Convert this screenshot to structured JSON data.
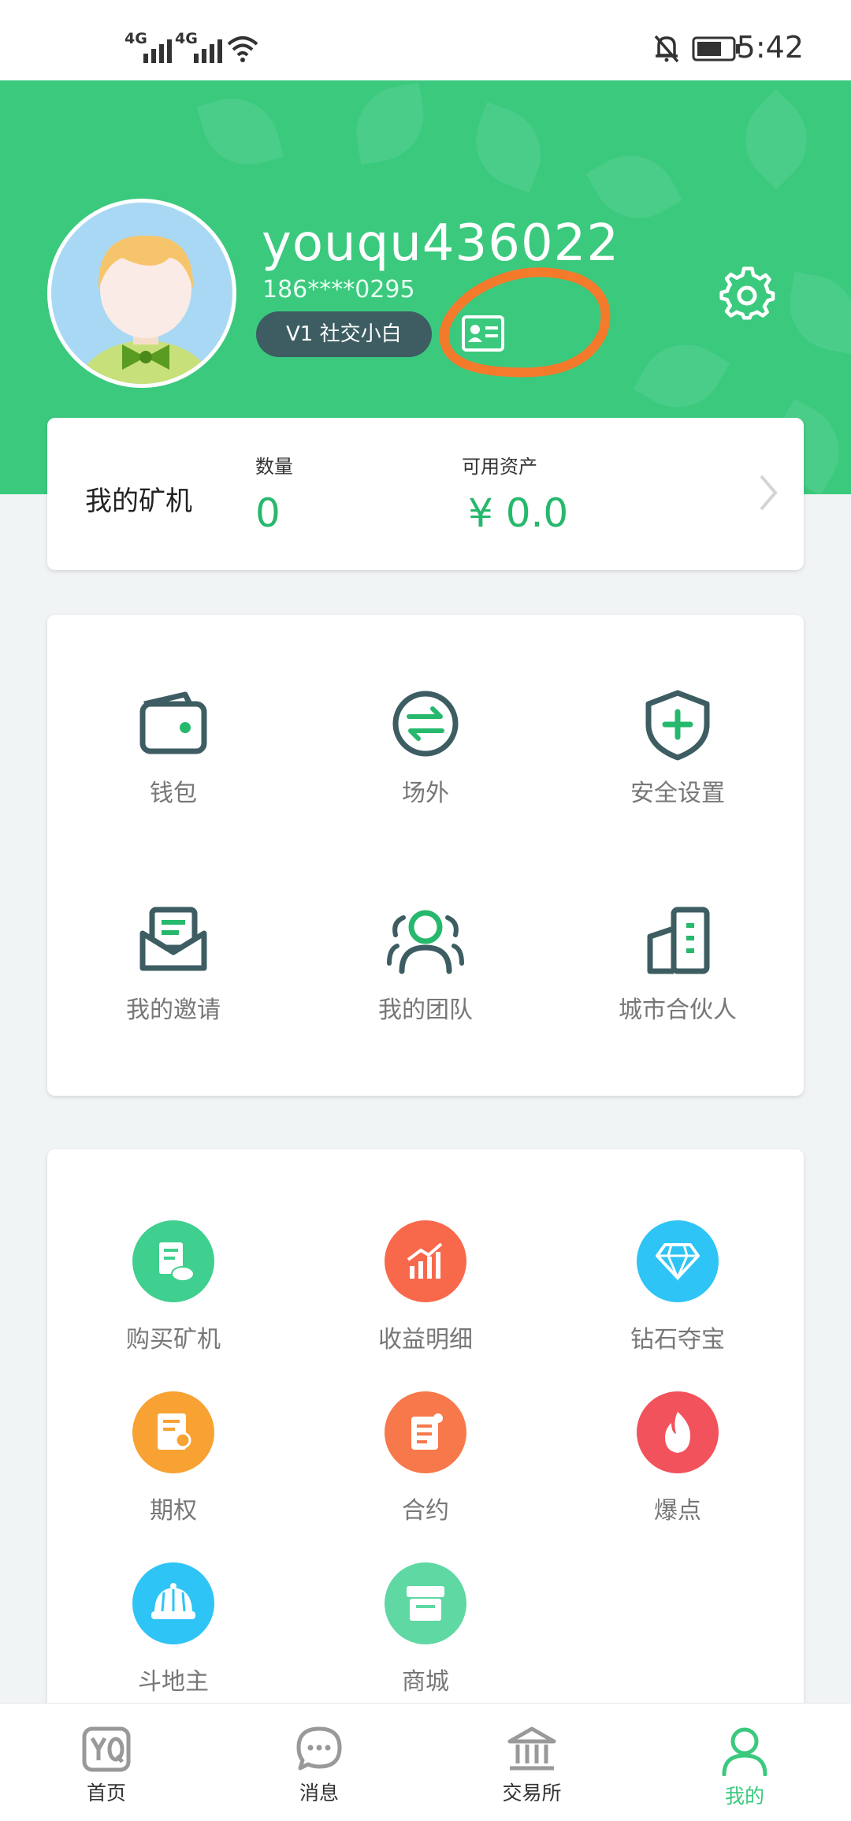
{
  "status_bar": {
    "net1": "4G",
    "net2": "4G",
    "time": "5:42"
  },
  "profile": {
    "username": "youqu436022",
    "phone": "186****0295",
    "level_badge": "V1 社交小白"
  },
  "mining": {
    "title": "我的矿机",
    "quantity_label": "数量",
    "quantity_value": "0",
    "assets_label": "可用资产",
    "assets_value": "¥ 0.0"
  },
  "menu1": {
    "items": [
      {
        "label": "钱包",
        "icon": "wallet-icon"
      },
      {
        "label": "场外",
        "icon": "exchange-icon"
      },
      {
        "label": "安全设置",
        "icon": "shield-icon"
      },
      {
        "label": "我的邀请",
        "icon": "invite-envelope-icon"
      },
      {
        "label": "我的团队",
        "icon": "team-icon"
      },
      {
        "label": "城市合伙人",
        "icon": "buildings-icon"
      }
    ]
  },
  "menu2": {
    "items": [
      {
        "label": "购买矿机",
        "icon": "buy-miner-icon",
        "color": "#3fcf8e"
      },
      {
        "label": "收益明细",
        "icon": "chart-icon",
        "color": "#f8694c"
      },
      {
        "label": "钻石夺宝",
        "icon": "diamond-icon",
        "color": "#2ec4f5"
      },
      {
        "label": "期权",
        "icon": "option-doc-icon",
        "color": "#f8a233"
      },
      {
        "label": "合约",
        "icon": "contract-icon",
        "color": "#f7784a"
      },
      {
        "label": "爆点",
        "icon": "flame-icon",
        "color": "#f2525c"
      },
      {
        "label": "斗地主",
        "icon": "landlord-hat-icon",
        "color": "#2ec4f5"
      },
      {
        "label": "商城",
        "icon": "store-icon",
        "color": "#5fd8a4"
      }
    ]
  },
  "bottom_nav": {
    "items": [
      {
        "label": "首页",
        "icon": "home-yq-icon"
      },
      {
        "label": "消息",
        "icon": "message-icon"
      },
      {
        "label": "交易所",
        "icon": "exchange-building-icon"
      },
      {
        "label": "我的",
        "icon": "profile-icon",
        "active": true
      }
    ]
  },
  "colors": {
    "brand_green": "#3bc97e",
    "dark_teal": "#3d5d62",
    "annotation_orange": "#f47a2c"
  }
}
